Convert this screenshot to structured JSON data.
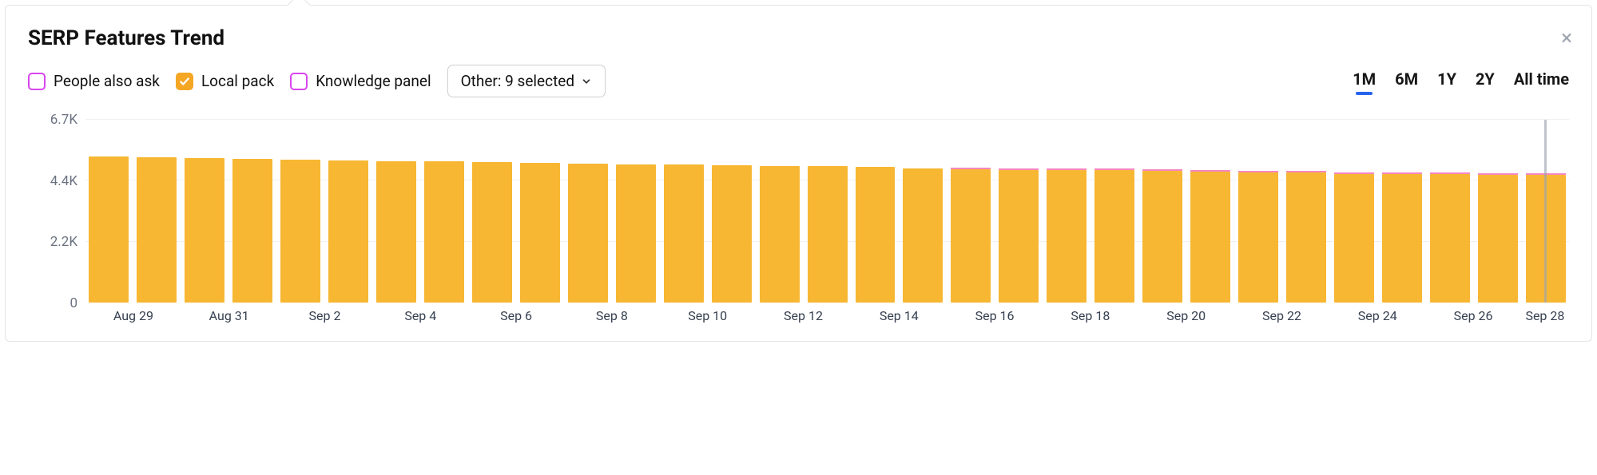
{
  "title": "SERP Features Trend",
  "close_icon": "×",
  "filters": {
    "people_also_ask": {
      "label": "People also ask",
      "checked": false,
      "color": "#d946ef"
    },
    "local_pack": {
      "label": "Local pack",
      "checked": true,
      "color": "#f5a623"
    },
    "knowledge_panel": {
      "label": "Knowledge panel",
      "checked": false,
      "color": "#d946ef"
    }
  },
  "other_dropdown": {
    "label": "Other: 9 selected"
  },
  "range_tabs": {
    "items": [
      "1M",
      "6M",
      "1Y",
      "2Y",
      "All time"
    ],
    "active": "1M"
  },
  "chart_data": {
    "type": "bar",
    "categories": [
      "Aug 29",
      "Aug 30",
      "Aug 31",
      "Sep 1",
      "Sep 2",
      "Sep 3",
      "Sep 4",
      "Sep 5",
      "Sep 6",
      "Sep 7",
      "Sep 8",
      "Sep 9",
      "Sep 10",
      "Sep 11",
      "Sep 12",
      "Sep 13",
      "Sep 14",
      "Sep 15",
      "Sep 16",
      "Sep 17",
      "Sep 18",
      "Sep 19",
      "Sep 20",
      "Sep 21",
      "Sep 22",
      "Sep 23",
      "Sep 24",
      "Sep 25",
      "Sep 26",
      "Sep 27",
      "Sep 28"
    ],
    "x_tick_labels": [
      "Aug 29",
      "Aug 31",
      "Sep 2",
      "Sep 4",
      "Sep 6",
      "Sep 8",
      "Sep 10",
      "Sep 12",
      "Sep 14",
      "Sep 16",
      "Sep 18",
      "Sep 20",
      "Sep 22",
      "Sep 24",
      "Sep 26",
      "Sep 28"
    ],
    "series": [
      {
        "name": "Local pack",
        "color": "#f7b733",
        "values": [
          5350,
          5320,
          5300,
          5260,
          5230,
          5220,
          5180,
          5170,
          5140,
          5130,
          5090,
          5070,
          5050,
          5040,
          5010,
          5000,
          4980,
          4930,
          4890,
          4870,
          4870,
          4860,
          4840,
          4800,
          4780,
          4760,
          4720,
          4700,
          4700,
          4680,
          4680
        ]
      }
    ],
    "pink_cap_from_index": 18,
    "cursor_index": 30,
    "title": "",
    "xlabel": "",
    "ylabel": "",
    "y_ticks": [
      "0",
      "2.2K",
      "4.4K",
      "6.7K"
    ],
    "ylim": [
      0,
      6700
    ]
  }
}
